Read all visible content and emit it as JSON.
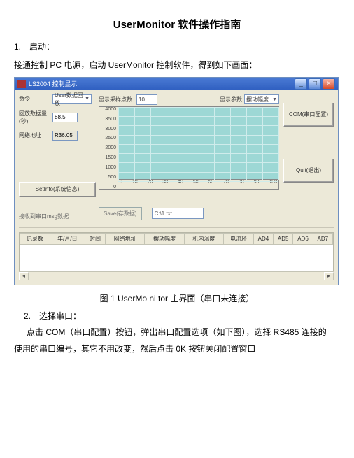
{
  "doc": {
    "title": "UserMonitor 软件操作指南",
    "step1_header": "1.　启动：",
    "step1_text": "接通控制 PC 电源，启动 UserMonitor 控制软件，得到如下画面：",
    "caption1": "图 1 UserMo ni tor 主界面（串口未连接）",
    "step2_header": "2.　选择串口：",
    "step2_text1": "点击 COM（串口配置）按钮，弹出串口配置选项（如下图），选择 RS485 连接的",
    "step2_text2": "使用的串口编号，其它不用改变，然后点击 0K 按钮关闭配置窗口"
  },
  "win": {
    "title": "LS2004 控制显示",
    "fields": {
      "cmd_label": "命令",
      "cmd_value": "User数据回放",
      "count_label": "回放数据量(秒)",
      "count_value": "88.5",
      "addr_label": "网络地址",
      "addr_value": "R36.05",
      "count_footer": ""
    },
    "chart_header": {
      "samples_label": "显示采样点数",
      "samples_value": "10",
      "params_label": "显示参数",
      "params_value": "摆动幅度"
    },
    "buttons": {
      "com": "COM(串口配置)",
      "quit": "Quit(退出)",
      "setinfo": "SetInfo(系统信息)",
      "save": "Save(存数据)"
    },
    "save_file": "C:\\1.txt",
    "lower_label": "接收到串口msg数据",
    "table_headers": [
      "记录数",
      "年/月/日",
      "时间",
      "网络地址",
      "摆动幅度",
      "机内温度",
      "电流环",
      "AD4",
      "AD5",
      "AD6",
      "AD7"
    ]
  },
  "chart_data": {
    "type": "line",
    "title": "",
    "xlabel": "",
    "ylabel": "",
    "y_ticks": [
      4000,
      3500,
      3000,
      2500,
      2000,
      1500,
      1000,
      500,
      0
    ],
    "x_ticks": [
      0,
      10,
      20,
      30,
      40,
      50,
      60,
      70,
      80,
      90,
      100
    ],
    "xlim": [
      0,
      100
    ],
    "ylim": [
      0,
      4000
    ],
    "series": []
  }
}
